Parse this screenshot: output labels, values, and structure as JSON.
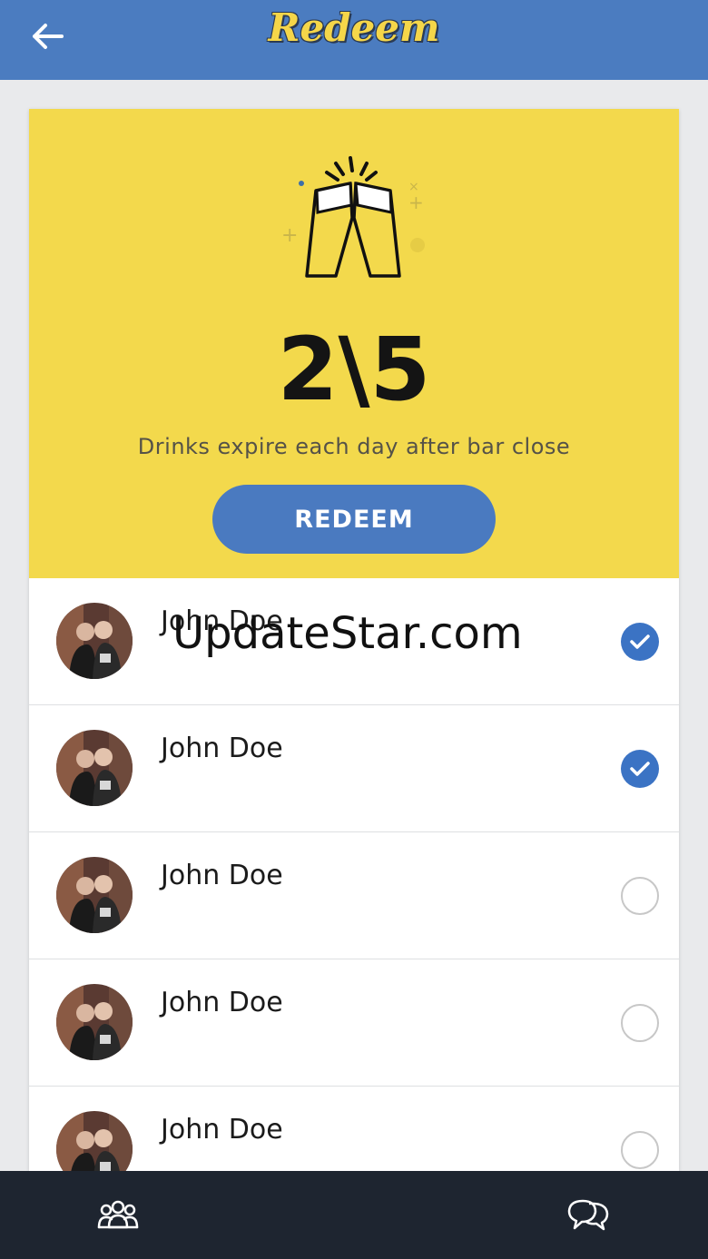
{
  "header": {
    "title": "Redeem",
    "back_icon": "arrow-left-icon",
    "background": "#4b7cc0",
    "title_color": "#f5d649"
  },
  "hero": {
    "icon": "cheers-beer-icon",
    "counter": "2\\5",
    "subtitle": "Drinks expire each day after bar close",
    "button_label": "REDEEM",
    "background": "#f3d94c"
  },
  "friends": [
    {
      "name": "John Doe",
      "selected": true
    },
    {
      "name": "John Doe",
      "selected": true
    },
    {
      "name": "John Doe",
      "selected": false
    },
    {
      "name": "John Doe",
      "selected": false
    },
    {
      "name": "John Doe",
      "selected": false
    }
  ],
  "watermark": "UpdateStar.com",
  "bottom_nav": {
    "left_icon": "group-icon",
    "right_icon": "chat-bubbles-icon"
  },
  "colors": {
    "accent": "#3b73c4",
    "bottom_bar": "#1e2530"
  }
}
